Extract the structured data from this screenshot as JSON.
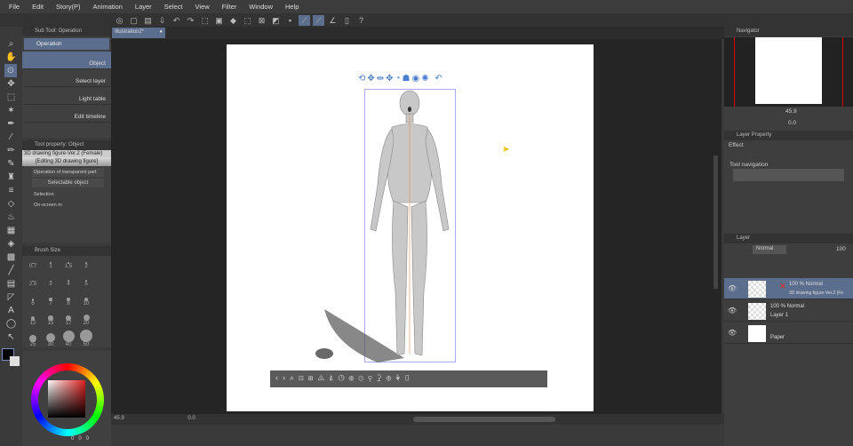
{
  "menu": [
    "File",
    "Edit",
    "Story(P)",
    "Animation",
    "Layer",
    "Select",
    "View",
    "Filter",
    "Window",
    "Help"
  ],
  "document_tab": "Illustration2*",
  "subtool": {
    "title": "Sub Tool: Operation",
    "group": "Operation",
    "items": [
      "Object",
      "Select layer",
      "Light table",
      "Edit timeline"
    ]
  },
  "tool_property": {
    "title": "Tool property: Object",
    "object_name": "3D drawing figure-Ver.2 (Female)",
    "mode": "[Editing 3D drawing figure]",
    "transparent_op": "Operation of transparent part",
    "selectable": "Selectable object",
    "selection_label": "Selection",
    "onscreen_label": "On-screen m"
  },
  "brush_size": {
    "title": "Brush Size",
    "sizes": [
      "0.7",
      "1",
      "1.5",
      "2",
      "2.5",
      "3",
      "4",
      "5",
      "6",
      "7",
      "8",
      "10",
      "12",
      "15",
      "17",
      "20",
      "25",
      "30",
      "40",
      "50"
    ]
  },
  "color": {
    "main": "#000000",
    "sub": "#e0e0e0",
    "values": [
      "0",
      "0",
      "0"
    ]
  },
  "navigator": {
    "title": "Navigator",
    "zoom": "45.9",
    "rotation": "0.0"
  },
  "layer_property": {
    "title": "Layer Property",
    "effect": "Effect",
    "tool_navigation": "Tool navigation"
  },
  "layer_panel": {
    "title": "Layer",
    "blend": "Normal",
    "opacity": "100",
    "layers": [
      {
        "mode": "100 % Normal",
        "name": "3D drawing figure-Ver.2 (Fe"
      },
      {
        "mode": "100 % Normal",
        "name": "Layer 1"
      },
      {
        "mode": "",
        "name": "Paper"
      }
    ]
  },
  "status": {
    "zoom": "45.9",
    "angle": "0.0"
  },
  "accent": "#5b6e8e"
}
